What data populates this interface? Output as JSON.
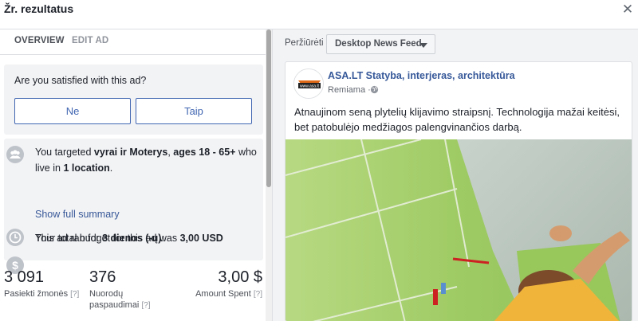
{
  "dialog": {
    "title": "Žr. rezultatus",
    "close_icon": "close-icon"
  },
  "tabs": {
    "overview": "OVERVIEW",
    "edit_ad": "EDIT AD"
  },
  "satisfaction": {
    "question": "Are you satisfied with this ad?",
    "no_label": "Ne",
    "yes_label": "Taip"
  },
  "summary": {
    "targeting_pre": "You targeted ",
    "targeting_audience": "vyrai ir Moterys",
    "targeting_sep": ", ",
    "targeting_ages": "ages 18 - 65+",
    "targeting_mid": " who live in ",
    "targeting_locations": "1 location",
    "targeting_end": ".",
    "show_full": "Show full summary",
    "ran_pre": "This ad ran for ",
    "ran_duration": "3 dienos (-ų)",
    "ran_end": ".",
    "budget_pre": "Your total budget for this ad was ",
    "budget_value": "3,00 USD"
  },
  "stats": {
    "reach_value": "3 091",
    "reach_label": "Pasiekti žmonės",
    "clicks_value": "376",
    "clicks_label_1": "Nuorodų",
    "clicks_label_2": "paspaudimai",
    "spent_value": "3,00 $",
    "spent_label": "Amount Spent",
    "help": "[?]"
  },
  "preview": {
    "label": "Peržiūrėti",
    "placement": "Desktop News Feed"
  },
  "post": {
    "page_name": "ASA.LT Statyba, interjeras, architektūra",
    "sponsored": "Remiama",
    "separator": "·",
    "text": "Atnaujinom seną plytelių klijavimo straipsnį. Technologija mažai keitėsi, bet patobulėjo medžiagos palengvinančios darbą.",
    "logo_text": "www.asa.lt"
  },
  "colors": {
    "accent": "#4267b2",
    "link": "#385898",
    "card_bg": "#f2f3f5",
    "tile_green": "#a9d36a"
  }
}
